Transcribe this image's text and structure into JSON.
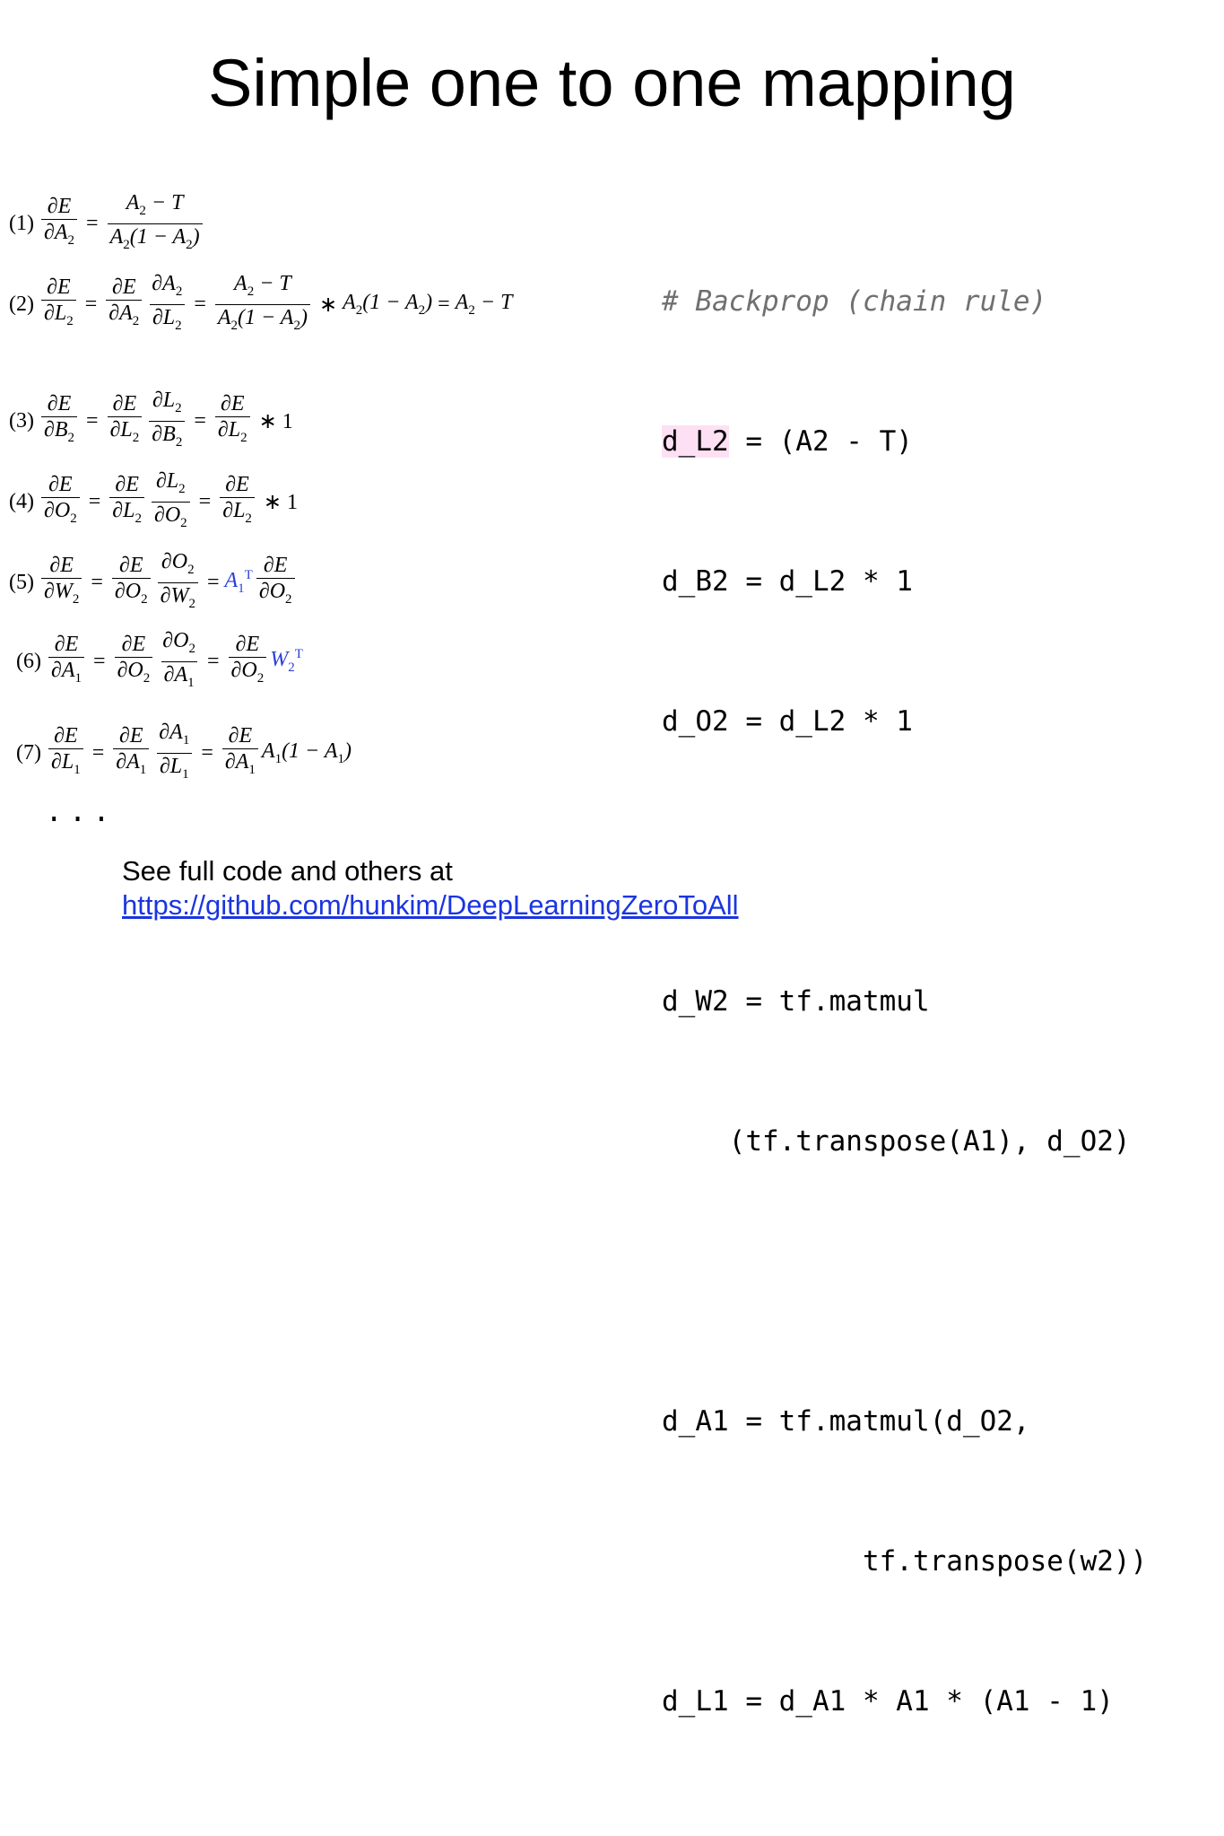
{
  "title": "Simple one to one mapping",
  "equations": [
    {
      "num": "(1)"
    },
    {
      "num": "(2)"
    },
    {
      "num": "(3)"
    },
    {
      "num": "(4)"
    },
    {
      "num": "(5)"
    },
    {
      "num": "(6)"
    },
    {
      "num": "(7)"
    }
  ],
  "math_ellipsis": "...",
  "code": {
    "comment": "# Backprop (chain rule)",
    "line1_var": "d_L2",
    "line1_rest": " = (A2 - T)",
    "line2": "d_B2 = d_L2 * 1",
    "line3": "d_O2 = d_L2 * 1",
    "line4": "d_W2 = tf.matmul",
    "line5": "    (tf.transpose(A1), d_O2)",
    "line6": "d_A1 = tf.matmul(d_O2,",
    "line7": "            tf.transpose(w2))",
    "line8": "d_L1 = d_A1 * A1 * (A1 - 1)",
    "line9": "..."
  },
  "footer": {
    "text": "See full code and others at",
    "link": "https://github.com/hunkim/DeepLearningZeroToAll"
  },
  "colors": {
    "highlight": "#fde0f4",
    "link": "#1a35e0",
    "math_blue": "#2a3fd8"
  }
}
